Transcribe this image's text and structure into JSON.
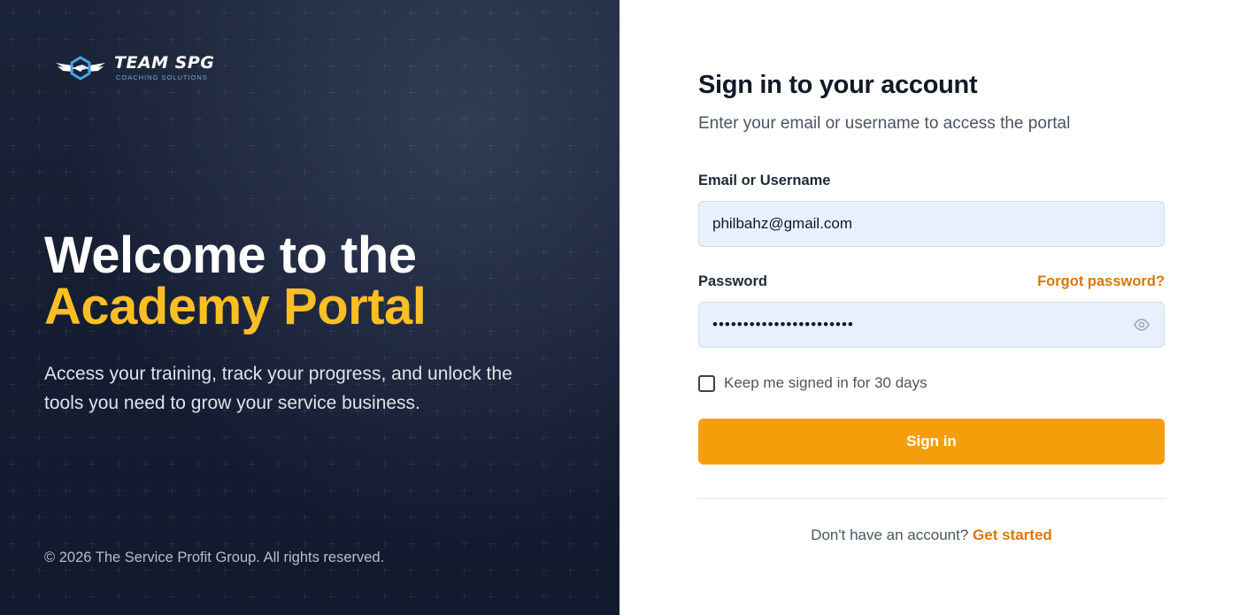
{
  "brand": {
    "name": "TEAM SPG",
    "tagline": "COACHING SOLUTIONS",
    "logo_icon": "handshake-wings-icon"
  },
  "hero": {
    "line1": "Welcome to the",
    "line2": "Academy Portal",
    "description": "Access your training, track your progress, and unlock the tools you need to grow your service business."
  },
  "footer": {
    "copyright": "© 2026 The Service Profit Group. All rights reserved."
  },
  "form": {
    "title": "Sign in to your account",
    "subtitle": "Enter your email or username to access the portal",
    "email_label": "Email or Username",
    "email_value": "philbahz@gmail.com",
    "password_label": "Password",
    "forgot_label": "Forgot password?",
    "password_masked": "•••••••••••••••••••••••",
    "password_toggle_icon": "eye-icon",
    "remember_label": "Keep me signed in for 30 days",
    "remember_checked": false,
    "submit_label": "Sign in",
    "signup_prompt": "Don't have an account?",
    "signup_link": "Get started"
  },
  "colors": {
    "accent": "#f59e0b",
    "accent_text": "#d97706",
    "hero_highlight": "#fbbf24",
    "left_bg": "#151d33",
    "input_bg": "#e8f0fe"
  }
}
